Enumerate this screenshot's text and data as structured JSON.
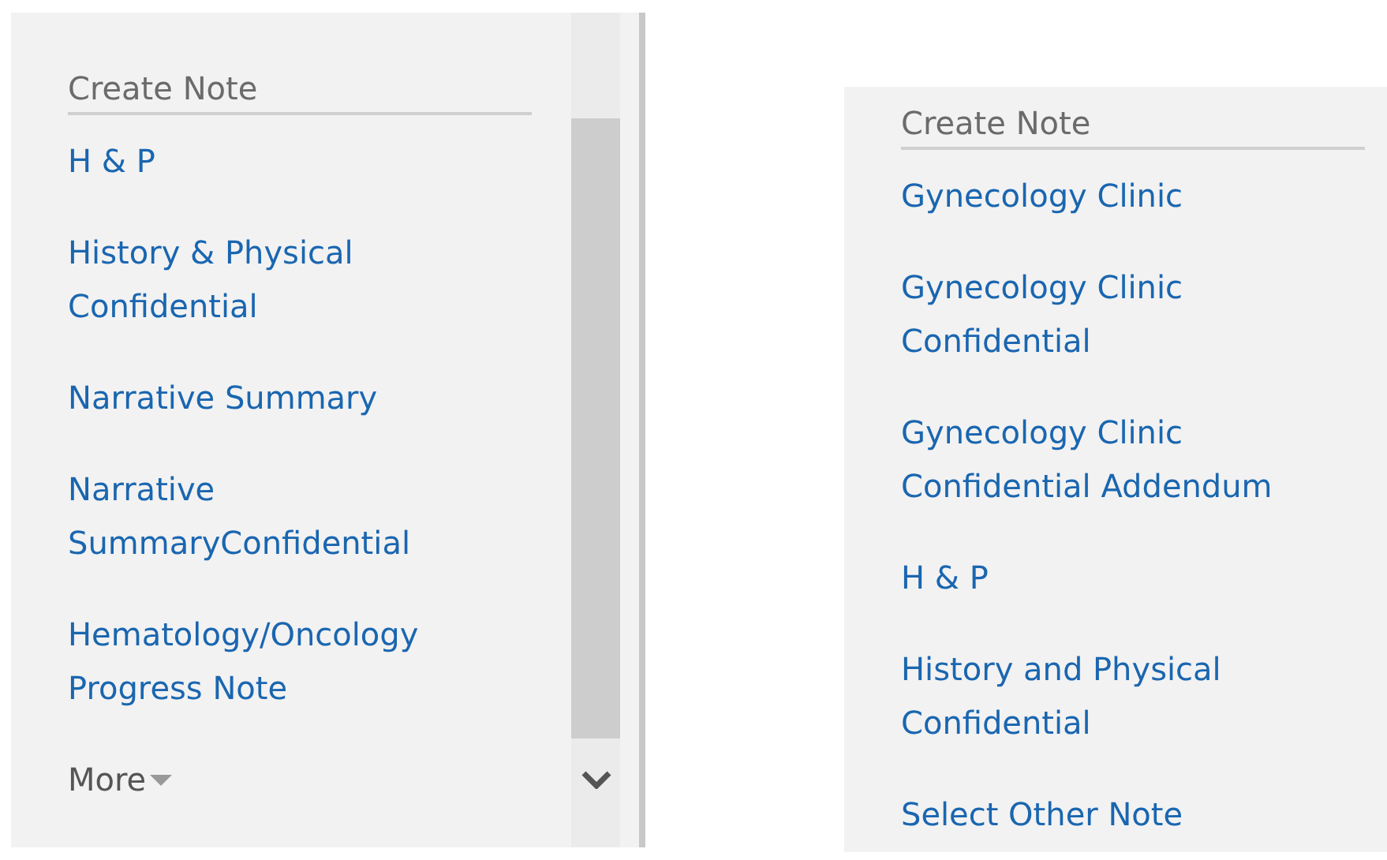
{
  "panels": [
    {
      "kind": "scrollable",
      "heading": "Create Note",
      "items": [
        {
          "lines": [
            "H & P"
          ]
        },
        {
          "lines": [
            "History & Physical",
            "Confidential"
          ]
        },
        {
          "lines": [
            "Narrative Summary"
          ]
        },
        {
          "lines": [
            "Narrative",
            "SummaryConfidential"
          ]
        },
        {
          "lines": [
            "Hematology/Oncology",
            "Progress Note"
          ]
        }
      ],
      "more": "More"
    },
    {
      "kind": "plain",
      "heading": "Create Note",
      "items": [
        {
          "lines": [
            "Gynecology Clinic"
          ]
        },
        {
          "lines": [
            "Gynecology Clinic",
            "Confidential"
          ]
        },
        {
          "lines": [
            "Gynecology Clinic",
            "Confidential Addendum"
          ]
        },
        {
          "lines": [
            "H & P"
          ]
        },
        {
          "lines": [
            "History and Physical",
            "Confidential"
          ]
        },
        {
          "lines": [
            "Select Other Note"
          ]
        }
      ]
    }
  ]
}
